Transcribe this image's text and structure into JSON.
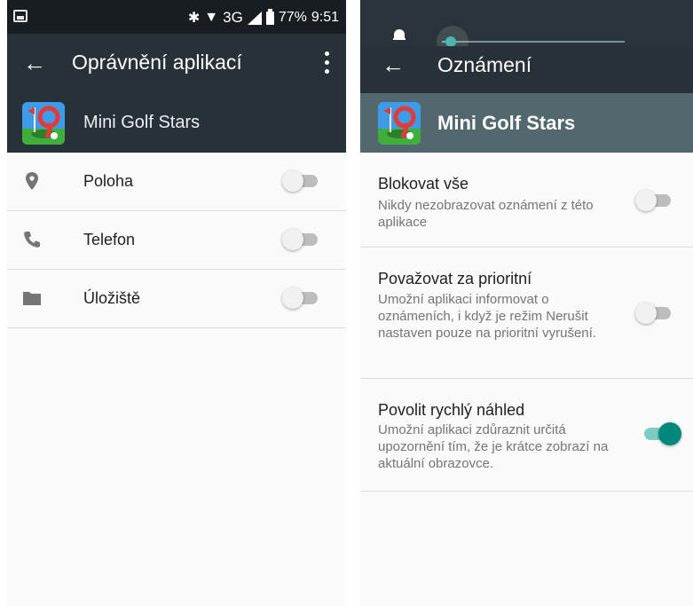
{
  "left_screen": {
    "status_bar": {
      "network": "3G",
      "battery": "77%",
      "time": "9:51"
    },
    "app_bar": {
      "back_icon": "arrow-back-icon",
      "title": "Oprávnění aplikací",
      "menu_icon": "more-vert-icon"
    },
    "app_header": {
      "icon": "mini-golf-stars-app-icon",
      "name": "Mini Golf Stars"
    },
    "permissions": [
      {
        "icon": "location-pin-icon",
        "label": "Poloha",
        "enabled": false
      },
      {
        "icon": "phone-icon",
        "label": "Telefon",
        "enabled": false
      },
      {
        "icon": "folder-icon",
        "label": "Úložiště",
        "enabled": false
      }
    ]
  },
  "right_screen": {
    "volume_panel": {
      "icon": "bell-icon",
      "level": 0.05
    },
    "app_bar": {
      "back_icon": "arrow-back-icon",
      "title": "Oznámení"
    },
    "app_header": {
      "icon": "mini-golf-stars-app-icon",
      "name": "Mini Golf Stars"
    },
    "settings": [
      {
        "title": "Blokovat vše",
        "summary": "Nikdy nezobrazovat oznámení z této aplikace",
        "enabled": false
      },
      {
        "title": "Považovat za prioritní",
        "summary": "Umožní aplikaci informovat o oznámeních, i když je režim Nerušit nastaven pouze na prioritní vyrušení.",
        "enabled": false
      },
      {
        "title": "Povolit rychlý náhled",
        "summary": "Umožní aplikaci zdůraznit určitá upozornění tím, že je krátce zobrazí na aktuální obrazovce.",
        "enabled": true
      }
    ]
  },
  "colors": {
    "status_bar": "#171d20",
    "app_bar": "#263238",
    "header_right": "#52676e",
    "accent": "#00897b",
    "accent_track": "#80cbc4"
  }
}
